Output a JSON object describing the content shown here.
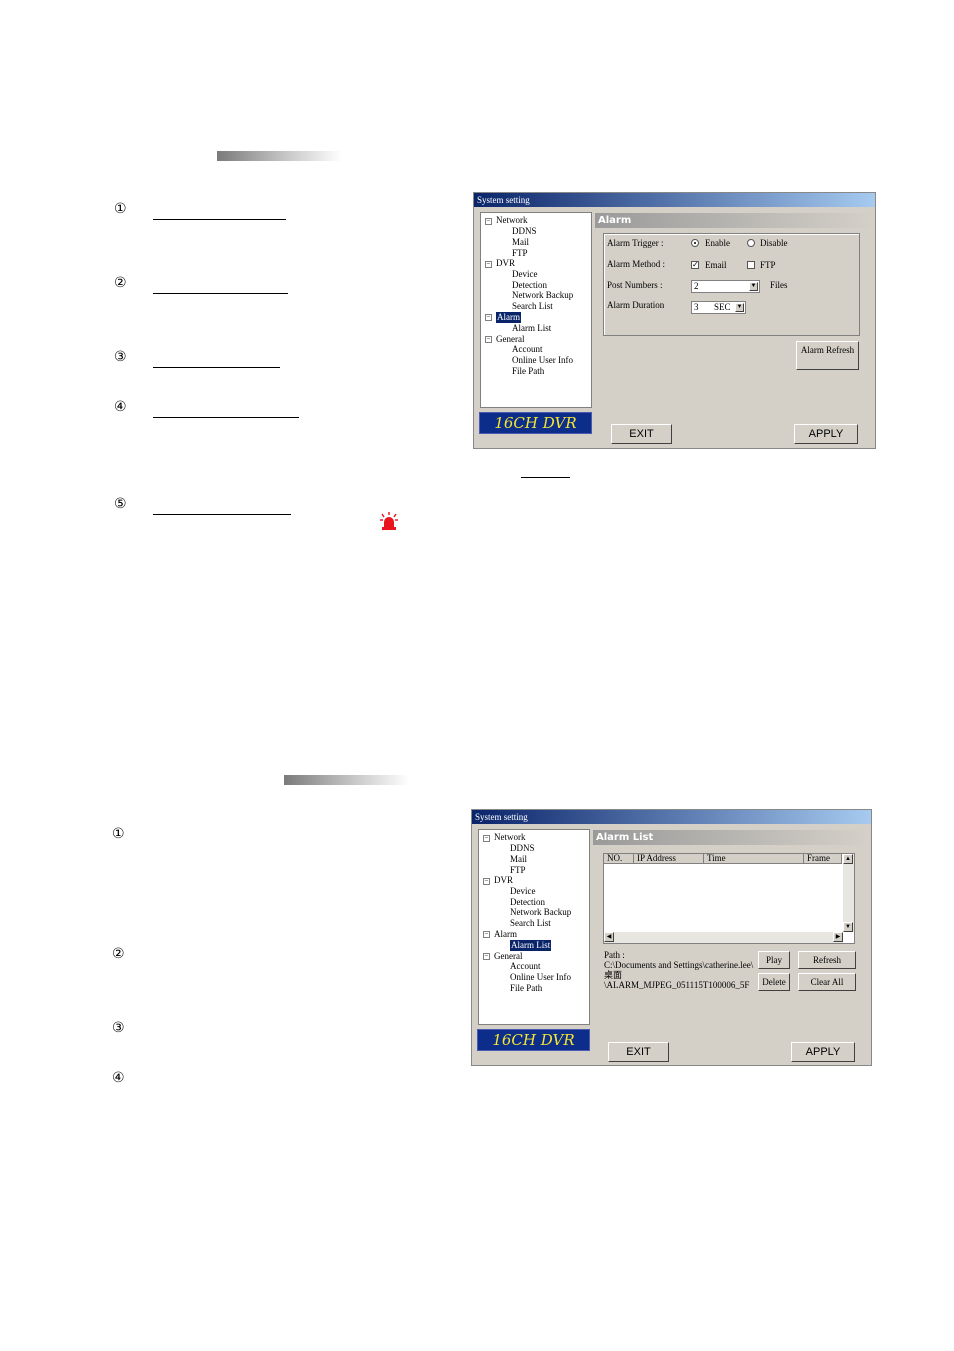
{
  "section1": {
    "steps": [
      "①",
      "②",
      "③",
      "④",
      "⑤"
    ]
  },
  "section2": {
    "steps": [
      "①",
      "②",
      "③",
      "④"
    ]
  },
  "window1": {
    "title": "System setting",
    "tree": [
      "Network",
      "DDNS",
      "Mail",
      "FTP",
      "DVR",
      "Device",
      "Detection",
      "Network Backup",
      "Search List",
      "Alarm",
      "Alarm List",
      "General",
      "Account",
      "Online User Info",
      "File Path"
    ],
    "selected": "Alarm",
    "brand": "16CH DVR",
    "panel_title": "Alarm",
    "alarm_trigger_label": "Alarm Trigger :",
    "enable_label": "Enable",
    "disable_label": "Disable",
    "alarm_method_label": "Alarm Method :",
    "email_label": "Email",
    "ftp_label": "FTP",
    "post_numbers_label": "Post Numbers :",
    "post_numbers_value": "2",
    "files_label": "Files",
    "alarm_duration_label": "Alarm Duration",
    "duration_value": "3",
    "duration_unit": "SEC",
    "refresh_button": "Alarm Refresh",
    "exit_button": "EXIT",
    "apply_button": "APPLY"
  },
  "window2": {
    "title": "System setting",
    "tree": [
      "Network",
      "DDNS",
      "Mail",
      "FTP",
      "DVR",
      "Device",
      "Detection",
      "Network Backup",
      "Search List",
      "Alarm",
      "Alarm List",
      "General",
      "Account",
      "Online User Info",
      "File Path"
    ],
    "selected": "Alarm List",
    "brand": "16CH DVR",
    "panel_title": "Alarm List",
    "columns": [
      "NO.",
      "IP Address",
      "Time",
      "Frame"
    ],
    "path_label": "Path :",
    "path_lines": [
      "C:\\Documents and Settings\\catherine.lee\\",
      "桌面",
      "\\ALARM_MJPEG_051115T100006_5F"
    ],
    "play_button": "Play",
    "refresh_button": "Refresh",
    "delete_button": "Delete",
    "clear_all_button": "Clear All",
    "exit_button": "EXIT",
    "apply_button": "APPLY"
  },
  "colors": {
    "selection": "#0a246a",
    "brand_bg": "#0c2d8a",
    "brand_text": "#f4e632",
    "alarm_red": "#e8141e"
  }
}
